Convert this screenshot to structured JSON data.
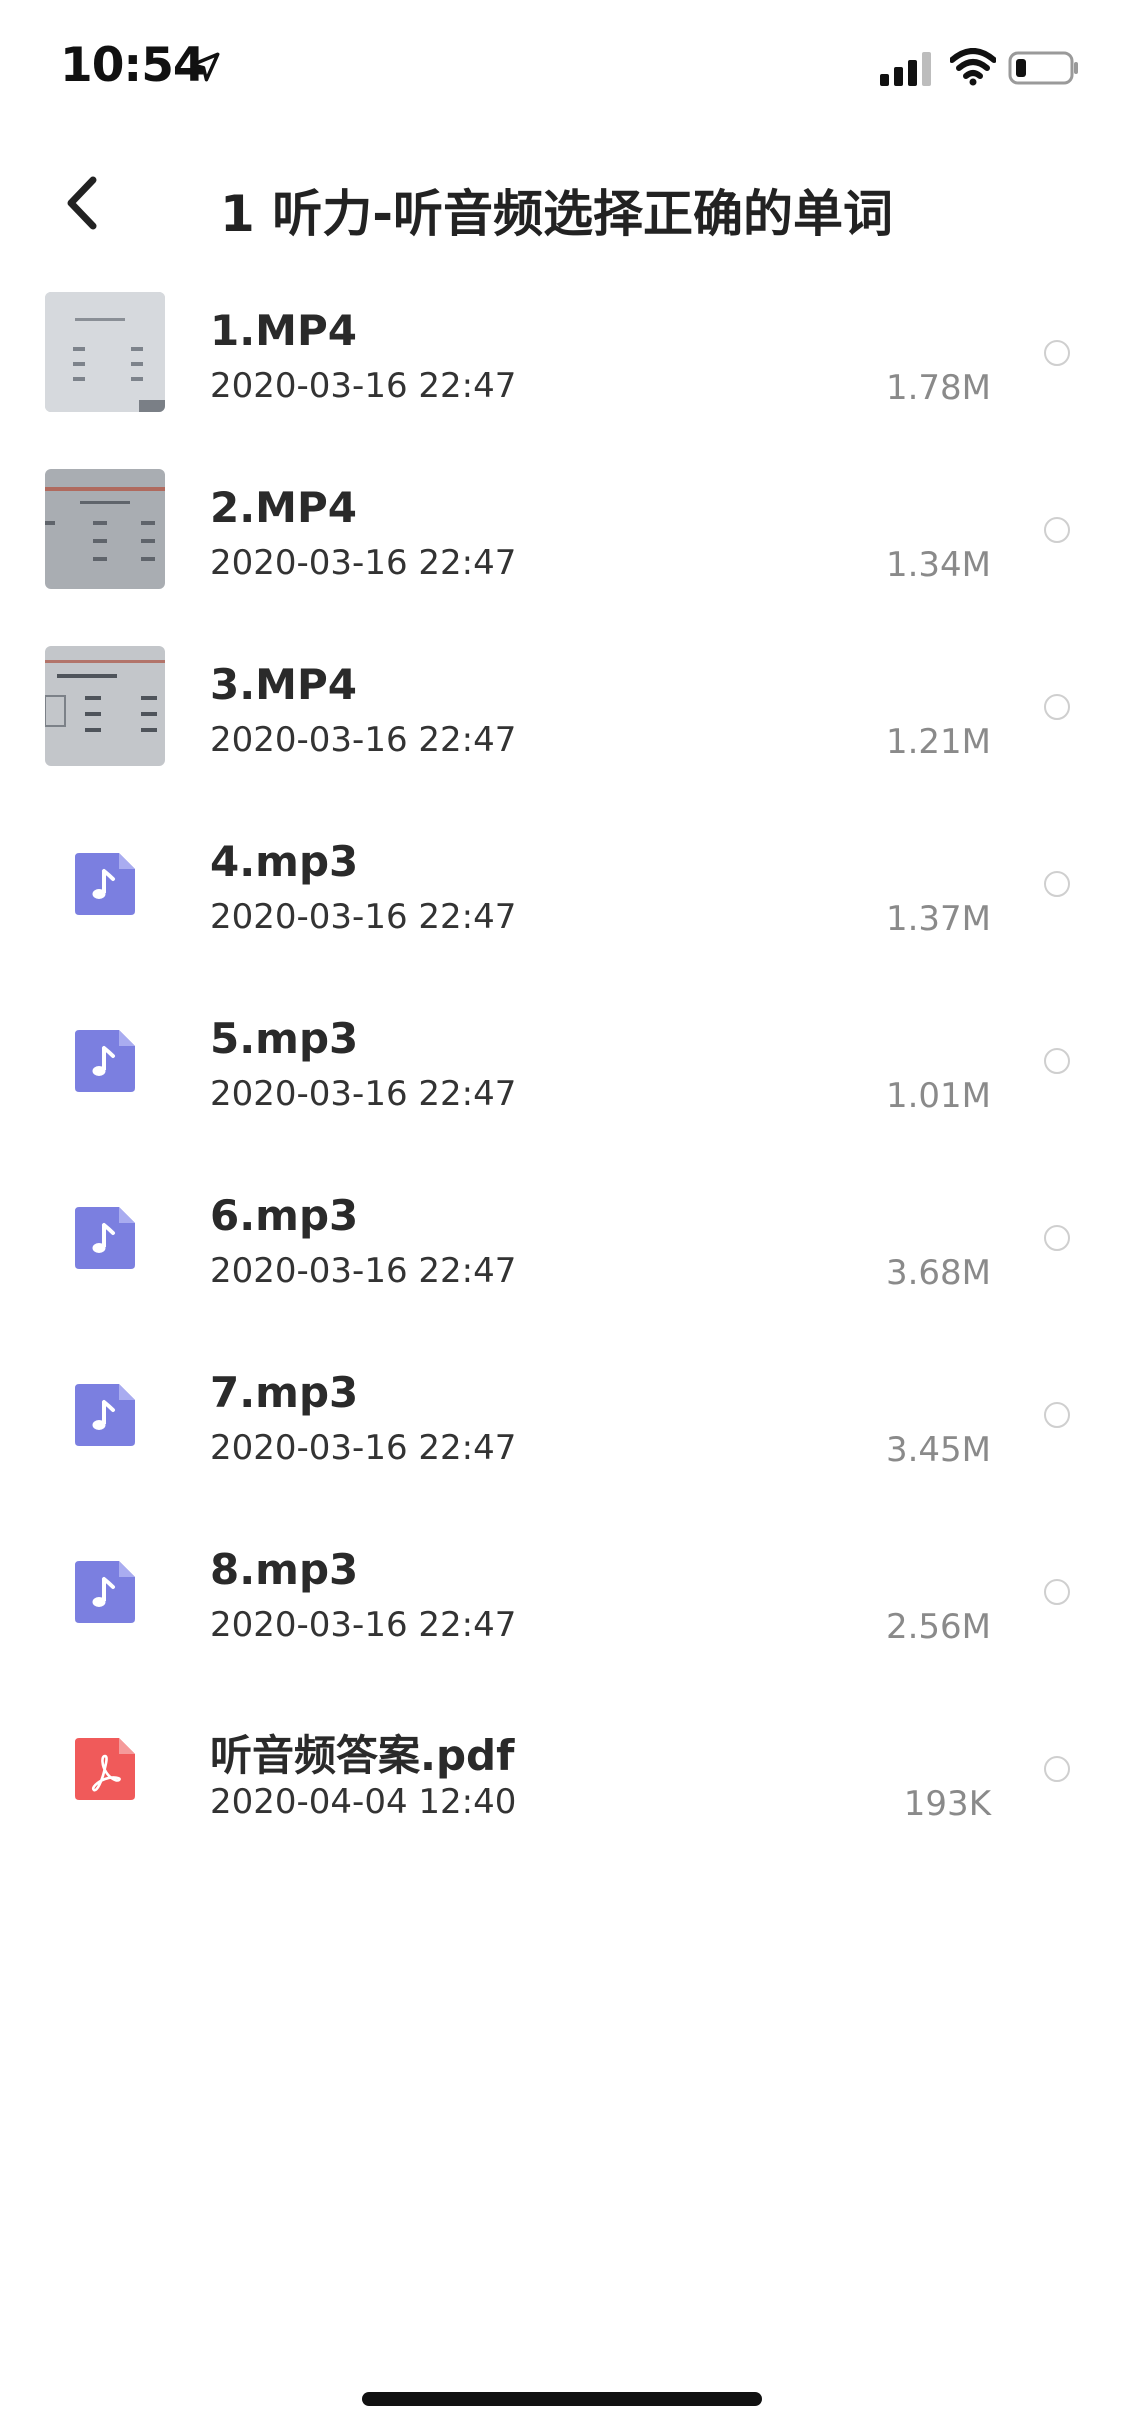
{
  "status_bar": {
    "time": "10:54"
  },
  "header": {
    "title": "1 听力-听音频选择正确的单词"
  },
  "files": [
    {
      "name": "1.MP4",
      "date": "2020-03-16 22:47",
      "size": "1.78M",
      "type": "video"
    },
    {
      "name": "2.MP4",
      "date": "2020-03-16 22:47",
      "size": "1.34M",
      "type": "video"
    },
    {
      "name": "3.MP4",
      "date": "2020-03-16 22:47",
      "size": "1.21M",
      "type": "video"
    },
    {
      "name": "4.mp3",
      "date": "2020-03-16 22:47",
      "size": "1.37M",
      "type": "audio"
    },
    {
      "name": "5.mp3",
      "date": "2020-03-16 22:47",
      "size": "1.01M",
      "type": "audio"
    },
    {
      "name": "6.mp3",
      "date": "2020-03-16 22:47",
      "size": "3.68M",
      "type": "audio"
    },
    {
      "name": "7.mp3",
      "date": "2020-03-16 22:47",
      "size": "3.45M",
      "type": "audio"
    },
    {
      "name": "8.mp3",
      "date": "2020-03-16 22:47",
      "size": "2.56M",
      "type": "audio"
    },
    {
      "name": "听音频答案.pdf",
      "date": "2020-04-04 12:40",
      "size": "193K",
      "type": "pdf"
    }
  ],
  "colors": {
    "audio_icon": "#7b7fe0",
    "pdf_icon": "#f05a5a",
    "radio_border": "#cfcfcf"
  },
  "icons": {
    "back": "chevron-left-icon",
    "audio": "music-note-icon",
    "pdf": "acrobat-icon",
    "video": "video-thumbnail"
  }
}
